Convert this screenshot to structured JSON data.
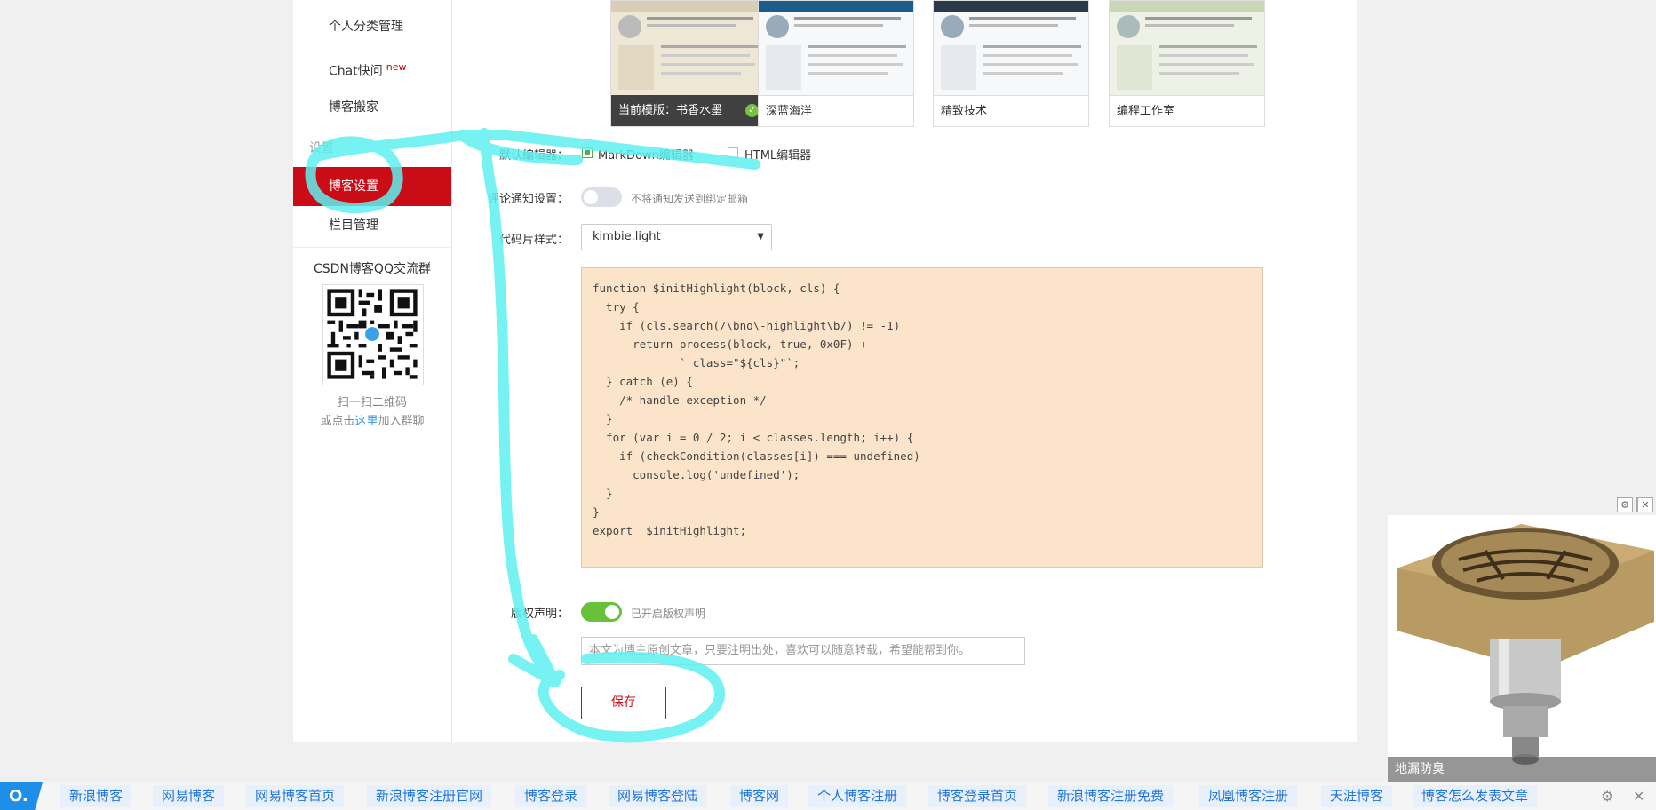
{
  "sidebar": {
    "items_top": [
      {
        "label": "个人分类管理"
      },
      {
        "label": "Chat快问",
        "badge": "new"
      },
      {
        "label": "博客搬家"
      }
    ],
    "section_label": "设置",
    "items_settings": [
      {
        "label": "博客设置",
        "active": true
      },
      {
        "label": "栏目管理"
      }
    ],
    "qq_group": {
      "title": "CSDN博客QQ交流群",
      "note_line1": "扫一扫二维码",
      "note_prefix": "或点击",
      "note_link": "这里",
      "note_suffix": "加入群聊"
    }
  },
  "templates": [
    {
      "label": "当前模版：书香水墨",
      "current": true
    },
    {
      "label": "深蓝海洋"
    },
    {
      "label": "精致技术"
    },
    {
      "label": "编程工作室"
    }
  ],
  "editor": {
    "label": "默认编辑器：",
    "markdown_label": "MarkDown编辑器",
    "markdown_checked": true,
    "html_label": "HTML编辑器",
    "html_checked": false
  },
  "comment_notify": {
    "label": "评论通知设置：",
    "enabled": false,
    "hint": "不将通知发送到绑定邮箱"
  },
  "code_style": {
    "label": "代码片样式：",
    "selected": "kimbie.light"
  },
  "code_sample": {
    "lines": [
      "function $initHighlight(block, cls) {",
      "  try {",
      "    if (cls.search(/\\bno\\-highlight\\b/) != -1)",
      "      return process(block, true, 0x0F) +",
      "             ` class=\"${cls}\"`;",
      "  } catch (e) {",
      "    /* handle exception */",
      "  }",
      "  for (var i = 0 / 2; i < classes.length; i++) {",
      "    if (checkCondition(classes[i]) === undefined)",
      "      console.log('undefined');",
      "  }",
      "}",
      "",
      "export  $initHighlight;"
    ]
  },
  "copyright": {
    "label": "版权声明：",
    "enabled": true,
    "hint": "已开启版权声明",
    "placeholder": "本文为博主原创文章，只要注明出处，喜欢可以随意转载，希望能帮到你。"
  },
  "save_label": "保存",
  "ad": {
    "caption": "地漏防臭",
    "info_icon": "gear-icon",
    "close_icon": "close-icon"
  },
  "bottom_bar": {
    "logo": "O.",
    "links": [
      "新浪博客",
      "网易博客",
      "网易博客首页",
      "新浪博客注册官网",
      "博客登录",
      "网易博客登陆",
      "博客网",
      "个人博客注册",
      "博客登录首页",
      "新浪博客注册免费",
      "凤凰博客注册",
      "天涯博客",
      "博客怎么发表文章"
    ],
    "settings_icon": "gear-icon",
    "close_icon": "close-icon"
  },
  "colors": {
    "accent_red": "#ca0c16",
    "toggle_on": "#67c23a",
    "toggle_off": "#dcdfe6",
    "annotation": "#5ff0f0",
    "link_blue": "#1e74d8"
  }
}
